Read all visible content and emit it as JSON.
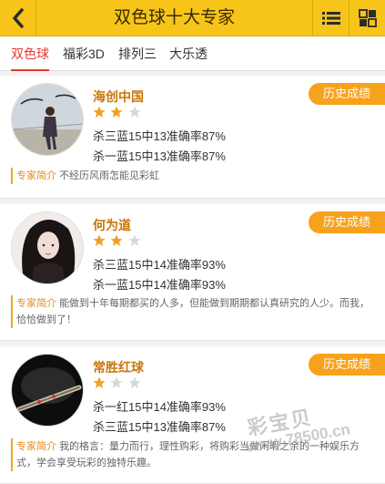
{
  "header": {
    "title": "双色球十大专家",
    "back_icon": "chevron-left-icon",
    "menu_icon": "list-menu-icon",
    "grid_icon": "grid-icon"
  },
  "tabs": [
    {
      "label": "双色球",
      "active": true
    },
    {
      "label": "福彩3D",
      "active": false
    },
    {
      "label": "排列三",
      "active": false
    },
    {
      "label": "大乐透",
      "active": false
    }
  ],
  "experts": [
    {
      "name": "海创中国",
      "rating": 2,
      "rating_max": 3,
      "stats": [
        "杀三蓝15中13准确率87%",
        "杀一蓝15中13准确率87%"
      ],
      "button": "历史成绩",
      "intro_label": "专家简介",
      "intro": "不经历风雨怎能见彩虹"
    },
    {
      "name": "何为道",
      "rating": 2,
      "rating_max": 3,
      "stats": [
        "杀三蓝15中14准确率93%",
        "杀一蓝15中14准确率93%"
      ],
      "button": "历史成绩",
      "intro_label": "专家简介",
      "intro": "能做到十年每期都买的人多，但能做到期期都认真研究的人少。而我，恰恰做到了！"
    },
    {
      "name": "常胜红球",
      "rating": 1,
      "rating_max": 3,
      "stats": [
        "杀一红15中14准确率93%",
        "杀三蓝15中13准确率87%"
      ],
      "button": "历史成绩",
      "intro_label": "专家简介",
      "intro": "我的格言：量力而行，理性购彩，将购彩当做闲暇之余的一种娱乐方式，学会享受玩彩的独特乐趣。"
    }
  ],
  "watermark": {
    "brand": "彩宝贝",
    "url": "www.78500.cn"
  },
  "colors": {
    "header_bg": "#f7c51a",
    "accent_orange": "#f7a21c",
    "active_tab": "#e23a2e",
    "expert_name": "#c9760a",
    "star_on": "#f0a020",
    "star_off": "#d8d8d8"
  }
}
